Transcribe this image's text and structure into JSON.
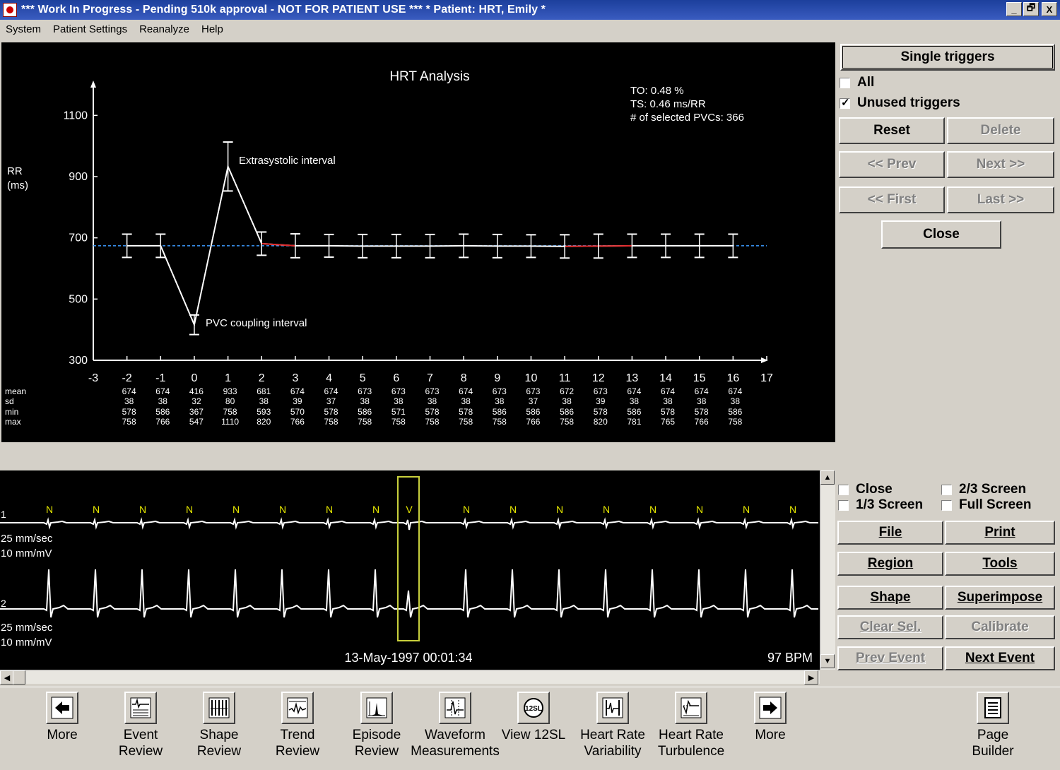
{
  "window": {
    "title": "*** Work In Progress - Pending 510k approval - NOT FOR PATIENT USE ***   *  Patient: HRT,  Emily  *",
    "controls": [
      "_",
      "🗗",
      "X"
    ]
  },
  "menu": [
    "System",
    "Patient Settings",
    "Reanalyze",
    "Help"
  ],
  "chart": {
    "title": "HRT Analysis",
    "ylabel_line1": "RR",
    "ylabel_line2": "(ms)",
    "info": {
      "to": "TO:   0.48 %",
      "ts": "TS:   0.46 ms/RR",
      "pvcs": "# of selected PVCs: 366"
    },
    "annotations": {
      "extrasystolic": "Extrasystolic interval",
      "pvc": "PVC coupling interval"
    },
    "stat_labels": [
      "mean",
      "sd",
      "min",
      "max"
    ]
  },
  "chart_data": {
    "type": "line",
    "title": "HRT Analysis",
    "ylabel": "RR (ms)",
    "xlim": [
      -3,
      17
    ],
    "ylim": [
      300,
      1200
    ],
    "y_ticks": [
      300,
      500,
      700,
      900,
      1100
    ],
    "x_ticks": [
      -3,
      -2,
      -1,
      0,
      1,
      2,
      3,
      4,
      5,
      6,
      7,
      8,
      9,
      10,
      11,
      12,
      13,
      14,
      15,
      16,
      17
    ],
    "reference_line": 674,
    "x": [
      -2,
      -1,
      0,
      1,
      2,
      3,
      4,
      5,
      6,
      7,
      8,
      9,
      10,
      11,
      12,
      13,
      14,
      15,
      16
    ],
    "mean": [
      "674",
      "674",
      "416",
      "933",
      "681",
      "674",
      "674",
      "673",
      "673",
      "673",
      "674",
      "673",
      "673",
      "672",
      "673",
      "674",
      "674",
      "674",
      "674"
    ],
    "sd": [
      "38",
      "38",
      "32",
      "80",
      "38",
      "39",
      "37",
      "38",
      "38",
      "38",
      "38",
      "38",
      "37",
      "38",
      "39",
      "38",
      "38",
      "38",
      "38"
    ],
    "min": [
      "578",
      "586",
      "367",
      "758",
      "593",
      "570",
      "578",
      "586",
      "571",
      "578",
      "578",
      "586",
      "586",
      "586",
      "578",
      "586",
      "578",
      "578",
      "586"
    ],
    "max": [
      "758",
      "766",
      "547",
      "1110",
      "820",
      "766",
      "758",
      "758",
      "758",
      "758",
      "758",
      "758",
      "766",
      "758",
      "820",
      "781",
      "765",
      "766",
      "758"
    ]
  },
  "triggers": {
    "header": "Single triggers",
    "all_label": "All",
    "all_checked": false,
    "unused_label": "Unused triggers",
    "unused_checked": true,
    "reset": "Reset",
    "delete": "Delete",
    "prev": "<< Prev",
    "next": "Next >>",
    "first": "<< First",
    "last": "Last >>",
    "close": "Close"
  },
  "ecg": {
    "lead1_label": "1",
    "lead2_label": "2",
    "speed1": "25 mm/sec",
    "gain1": "10 mm/mV",
    "speed2": "25 mm/sec",
    "gain2": "10 mm/mV",
    "beats": [
      "N",
      "N",
      "N",
      "N",
      "N",
      "N",
      "N",
      "N",
      "V",
      "N",
      "N",
      "N",
      "N",
      "N",
      "N",
      "N",
      "N"
    ],
    "timestamp": "13-May-1997 00:01:34",
    "bpm": "97 BPM"
  },
  "view_options": {
    "close": "Close",
    "third": "1/3 Screen",
    "two_third": "2/3 Screen",
    "full": "Full Screen",
    "file": "File",
    "print": "Print",
    "region": "Region",
    "tools": "Tools",
    "shape": "Shape",
    "superimpose": "Superimpose",
    "clear_sel": "Clear Sel.",
    "calibrate": "Calibrate",
    "prev_event": "Prev Event",
    "next_event": "Next Event"
  },
  "toolbar": [
    {
      "l1": "More",
      "l2": "",
      "icon": "arrow-left-icon"
    },
    {
      "l1": "Event",
      "l2": "Review",
      "icon": "event-review-icon"
    },
    {
      "l1": "Shape",
      "l2": "Review",
      "icon": "shape-review-icon"
    },
    {
      "l1": "Trend",
      "l2": "Review",
      "icon": "trend-review-icon"
    },
    {
      "l1": "Episode",
      "l2": "Review",
      "icon": "episode-review-icon"
    },
    {
      "l1": "Waveform",
      "l2": "Measurements",
      "icon": "waveform-measurements-icon"
    },
    {
      "l1": "View 12SL",
      "l2": "",
      "icon": "view-12sl-icon"
    },
    {
      "l1": "Heart Rate",
      "l2": "Variability",
      "icon": "hrv-icon"
    },
    {
      "l1": "Heart Rate",
      "l2": "Turbulence",
      "icon": "hrt-icon"
    },
    {
      "l1": "More",
      "l2": "",
      "icon": "arrow-right-icon"
    },
    {
      "l1": "Page",
      "l2": "Builder",
      "icon": "page-builder-icon"
    }
  ]
}
